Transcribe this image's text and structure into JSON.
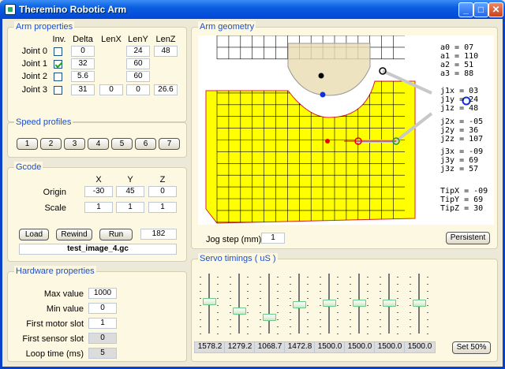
{
  "window": {
    "title": "Theremino Robotic Arm"
  },
  "arm_properties": {
    "title": "Arm properties",
    "headers": [
      "Inv.",
      "Delta",
      "LenX",
      "LenY",
      "LenZ"
    ],
    "joints": [
      {
        "label": "Joint 0",
        "inv": false,
        "delta": "0",
        "lenx": "",
        "leny": "24",
        "lenz": "48"
      },
      {
        "label": "Joint 1",
        "inv": true,
        "delta": "32",
        "lenx": "",
        "leny": "60",
        "lenz": ""
      },
      {
        "label": "Joint 2",
        "inv": false,
        "delta": "5.6",
        "lenx": "",
        "leny": "60",
        "lenz": ""
      },
      {
        "label": "Joint 3",
        "inv": false,
        "delta": "31",
        "lenx": "0",
        "leny": "0",
        "lenz": "26.6"
      }
    ]
  },
  "speed_profiles": {
    "title": "Speed profiles",
    "buttons": [
      "1",
      "2",
      "3",
      "4",
      "5",
      "6",
      "7"
    ]
  },
  "gcode": {
    "title": "Gcode",
    "headers": [
      "X",
      "Y",
      "Z"
    ],
    "origin_label": "Origin",
    "origin": [
      "-30",
      "45",
      "0"
    ],
    "scale_label": "Scale",
    "scale": [
      "1",
      "1",
      "1"
    ],
    "load_label": "Load",
    "rewind_label": "Rewind",
    "run_label": "Run",
    "line_number": "182",
    "file": "test_image_4.gc"
  },
  "hardware": {
    "title": "Hardware properties",
    "rows": [
      {
        "label": "Max value",
        "value": "1000"
      },
      {
        "label": "Min value",
        "value": "0"
      },
      {
        "label": "First motor slot",
        "value": "1"
      },
      {
        "label": "First sensor slot",
        "value": "0"
      },
      {
        "label": "Loop time (ms)",
        "value": "5"
      }
    ]
  },
  "geometry": {
    "title": "Arm geometry",
    "readouts": [
      "a0 = 07",
      "a1 = 110",
      "a2 = 51",
      "a3 = 88",
      "j1x = 03",
      "j1y = 24",
      "j1z = 48",
      "j2x = -05",
      "j2y = 36",
      "j2z = 107",
      "j3x = -09",
      "j3y = 69",
      "j3z = 57",
      "TipX = -09",
      "TipY = 69",
      "TipZ = 30"
    ],
    "jog_label": "Jog step (mm)",
    "jog_value": "1",
    "persistent_label": "Persistent",
    "colors": {
      "work_area": "#ffff00",
      "grid": "#000000",
      "base": "#e8dcb0",
      "arm": "#cccccc"
    }
  },
  "servo": {
    "title": "Servo timings  ( uS )",
    "values": [
      "1578.2",
      "1279.2",
      "1068.7",
      "1472.8",
      "1500.0",
      "1500.0",
      "1500.0",
      "1500.0"
    ],
    "positions": [
      0.52,
      0.37,
      0.26,
      0.48,
      0.5,
      0.5,
      0.5,
      0.5
    ],
    "set50_label": "Set 50%"
  }
}
